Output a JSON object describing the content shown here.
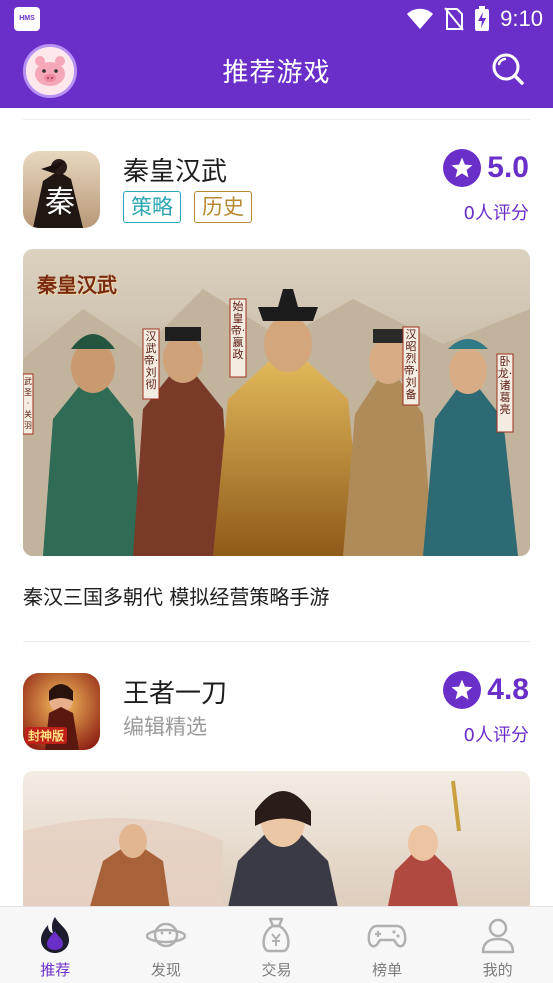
{
  "status_bar": {
    "badge": "HMS",
    "time": "9:10"
  },
  "header": {
    "title": "推荐游戏"
  },
  "games": [
    {
      "name": "秦皇汉武",
      "tags": [
        "策略",
        "历史"
      ],
      "rating": "5.0",
      "rating_count": "0人评分",
      "banner_title": "秦皇汉武",
      "banner_captions": [
        "始皇帝·嬴政",
        "汉武帝·刘彻",
        "汉昭烈帝·刘备",
        "卧龙·诸葛亮",
        "武圣·关羽"
      ],
      "description": "秦汉三国多朝代 模拟经营策略手游",
      "icon_glyph": "秦"
    },
    {
      "name": "王者一刀",
      "subtitle": "编辑精选",
      "rating": "4.8",
      "rating_count": "0人评分",
      "icon_glyph": "封神版"
    }
  ],
  "bottom_nav": [
    {
      "label": "推荐",
      "icon": "flame-icon",
      "active": true
    },
    {
      "label": "发现",
      "icon": "planet-icon",
      "active": false
    },
    {
      "label": "交易",
      "icon": "money-bag-icon",
      "active": false
    },
    {
      "label": "榜单",
      "icon": "gamepad-icon",
      "active": false
    },
    {
      "label": "我的",
      "icon": "user-icon",
      "active": false
    }
  ],
  "colors": {
    "primary": "#6b2fc9",
    "tag_teal": "#2ba6b3",
    "tag_gold": "#b88a30"
  }
}
